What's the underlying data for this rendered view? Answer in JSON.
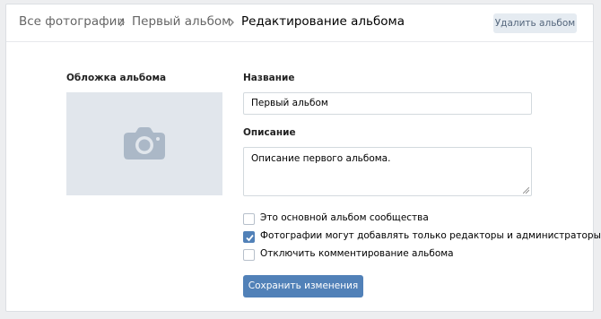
{
  "breadcrumb": {
    "items": [
      {
        "label": "Все фотографии"
      },
      {
        "label": "Первый альбом"
      },
      {
        "label": "Редактирование альбома"
      }
    ]
  },
  "header": {
    "delete_label": "Удалить альбом"
  },
  "cover": {
    "label": "Обложка альбома",
    "icon": "camera-icon"
  },
  "form": {
    "name_label": "Название",
    "name_value": "Первый альбом",
    "description_label": "Описание",
    "description_value": "Описание первого альбома.",
    "options": [
      {
        "label": "Это основной альбом сообщества",
        "checked": false
      },
      {
        "label": "Фотографии могут добавлять только редакторы и администраторы",
        "checked": true
      },
      {
        "label": "Отключить комментирование альбома",
        "checked": false
      }
    ],
    "save_label": "Сохранить изменения"
  },
  "colors": {
    "page_bg": "#edeef0",
    "accent": "#5181b8",
    "secondary_button_bg": "#e5ebf1",
    "cover_bg": "#e1e6ec",
    "camera_icon": "#abb8c7"
  }
}
